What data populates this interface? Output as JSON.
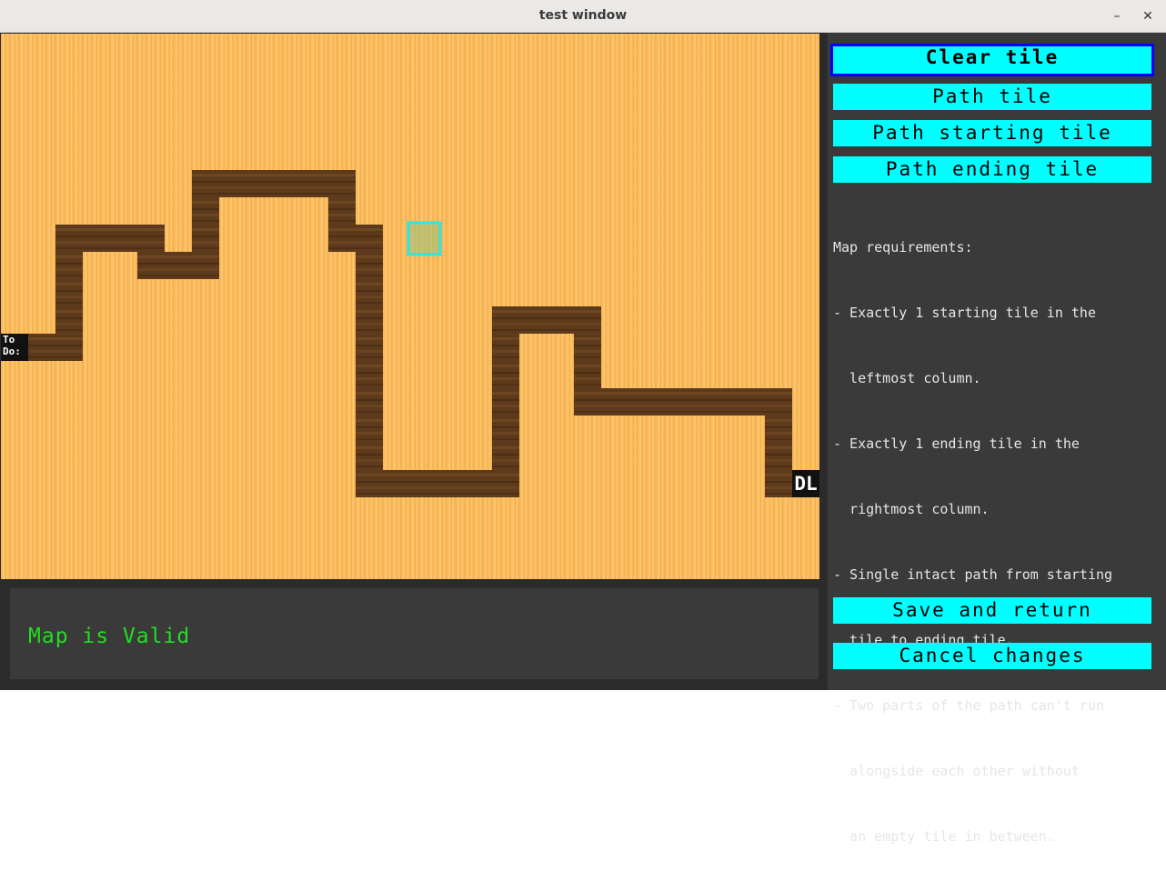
{
  "window": {
    "title": "test window",
    "minimize_glyph": "–",
    "close_glyph": "✕"
  },
  "map": {
    "start_label_line1": "To",
    "start_label_line2": "Do:",
    "end_label": "DL",
    "colors": {
      "grass": "#f7b657",
      "path": "#5d3a1c",
      "highlight": "#2ee6e6"
    }
  },
  "tools": {
    "clear_tile": "Clear tile",
    "path_tile": "Path tile",
    "path_start": "Path starting tile",
    "path_end": "Path ending tile",
    "selected": "clear_tile"
  },
  "requirements": {
    "heading": "Map requirements:",
    "lines": [
      "- Exactly 1 starting tile in the",
      "  leftmost column.",
      "- Exactly 1 ending tile in the",
      "  rightmost column.",
      "- Single intact path from starting",
      "  tile to ending tile.",
      "- Two parts of the path can't run",
      "  alongside each other without",
      "  an empty tile in between."
    ]
  },
  "actions": {
    "save": "Save and return",
    "cancel": "Cancel changes"
  },
  "status": {
    "text": "Map is Valid",
    "color": "#22dd22"
  }
}
